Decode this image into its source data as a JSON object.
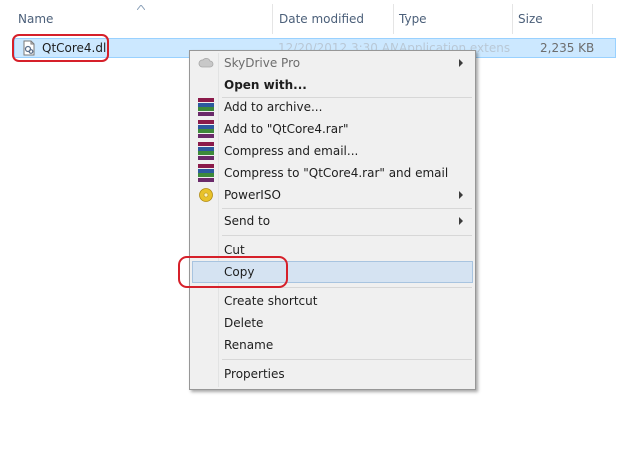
{
  "columns": {
    "name": "Name",
    "date_modified": "Date modified",
    "type": "Type",
    "size": "Size"
  },
  "file": {
    "name": "QtCore4.dll",
    "date_modified": "12/20/2012 3:30 AM",
    "type": "Application extens...",
    "size": "2,235 KB",
    "icon": "dll-file-icon"
  },
  "menu": {
    "items": [
      {
        "label": "SkyDrive Pro",
        "icon": "cloud-icon",
        "submenu": true,
        "disabled": true
      },
      {
        "label": "Open with...",
        "bold": true
      },
      {
        "label": "Add to archive...",
        "icon": "winrar-icon"
      },
      {
        "label": "Add to \"QtCore4.rar\"",
        "icon": "winrar-icon"
      },
      {
        "label": "Compress and email...",
        "icon": "winrar-icon"
      },
      {
        "label": "Compress to \"QtCore4.rar\" and email",
        "icon": "winrar-icon"
      },
      {
        "label": "PowerISO",
        "icon": "poweriso-icon",
        "submenu": true
      },
      {
        "label": "Send to",
        "submenu": true
      },
      {
        "label": "Cut"
      },
      {
        "label": "Copy",
        "highlighted": true
      },
      {
        "label": "Create shortcut"
      },
      {
        "label": "Delete"
      },
      {
        "label": "Rename"
      },
      {
        "label": "Properties"
      }
    ]
  },
  "colors": {
    "selection_bg": "#cce8ff",
    "selection_border": "#99d1ff",
    "menu_bg": "#f0f0f0",
    "hover_bg": "#d5e3f2",
    "annotation_red": "#d6202a"
  }
}
